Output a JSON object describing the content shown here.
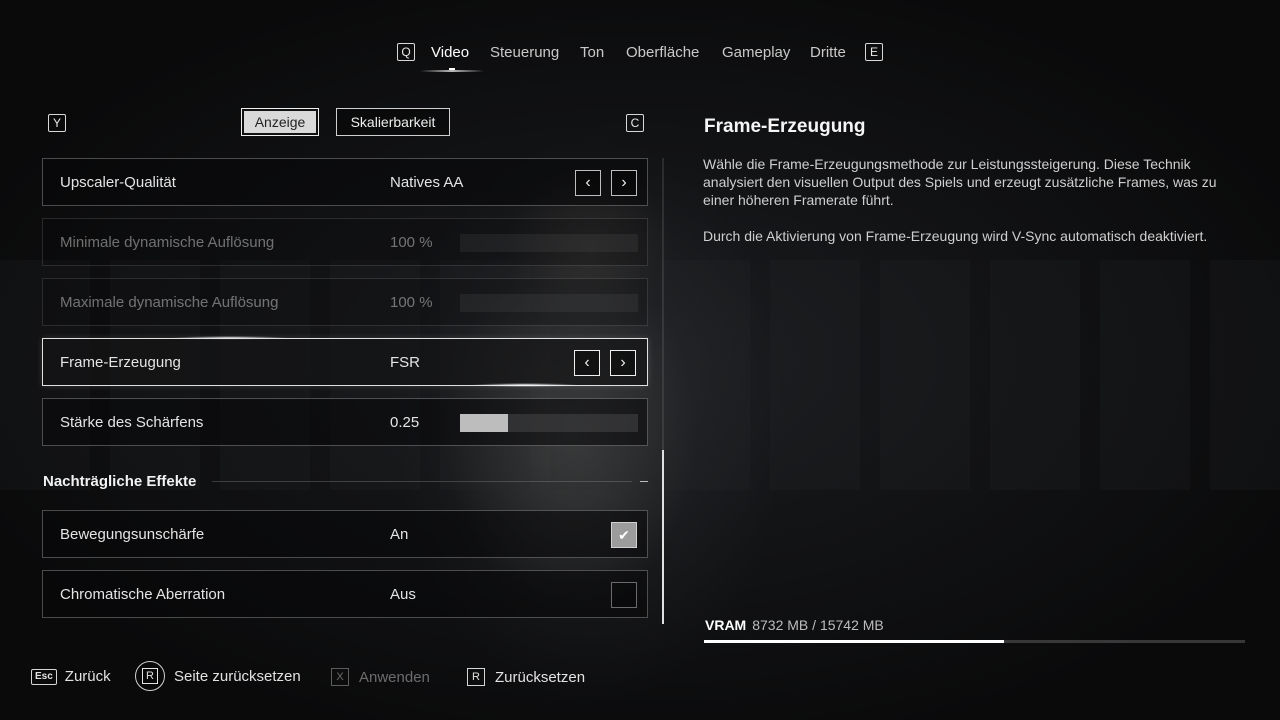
{
  "nav": {
    "left_key": "Q",
    "right_key": "E",
    "tabs": [
      {
        "label": "Video",
        "active": true
      },
      {
        "label": "Steuerung",
        "active": false
      },
      {
        "label": "Ton",
        "active": false
      },
      {
        "label": "Oberfläche",
        "active": false
      },
      {
        "label": "Gameplay",
        "active": false
      },
      {
        "label": "Dritte",
        "active": false
      }
    ]
  },
  "subnav": {
    "left_key": "Y",
    "right_key": "C",
    "tabs": [
      {
        "label": "Anzeige",
        "active": true
      },
      {
        "label": "Skalierbarkeit",
        "active": false
      }
    ]
  },
  "settings": {
    "rows": [
      {
        "label": "Upscaler-Qualität",
        "value": "Natives AA",
        "control": "selector",
        "disabled": false
      },
      {
        "label": "Minimale dynamische Auflösung",
        "value": "100 %",
        "control": "slider",
        "fill_fraction": 1.0,
        "disabled": true
      },
      {
        "label": "Maximale dynamische Auflösung",
        "value": "100 %",
        "control": "slider",
        "fill_fraction": 1.0,
        "disabled": true
      },
      {
        "label": "Frame-Erzeugung",
        "value": "FSR",
        "control": "selector",
        "disabled": false,
        "selected": true
      },
      {
        "label": "Stärke des Schärfens",
        "value": "0.25",
        "control": "slider",
        "fill_fraction": 0.27,
        "disabled": false
      }
    ],
    "section_title": "Nachträgliche Effekte",
    "section_rows": [
      {
        "label": "Bewegungsunschärfe",
        "value": "An",
        "control": "checkbox",
        "checked": true
      },
      {
        "label": "Chromatische Aberration",
        "value": "Aus",
        "control": "checkbox",
        "checked": false
      }
    ],
    "scroll_fraction": 0.63
  },
  "info": {
    "title": "Frame-Erzeugung",
    "paragraph1": "Wähle die Frame-Erzeugungsmethode zur Leistungssteigerung. Diese Technik analysiert den visuellen Output des Spiels und erzeugt zusätzliche Frames, was zu einer höheren Framerate führt.",
    "paragraph2": "Durch die Aktivierung von Frame-Erzeugung wird V-Sync automatisch deaktiviert."
  },
  "vram": {
    "label": "VRAM",
    "value": "8732 MB / 15742 MB",
    "used_fraction": 0.555
  },
  "footer": {
    "back": {
      "key": "Esc",
      "label": "Zurück"
    },
    "reset_page": {
      "key": "R",
      "label": "Seite zurücksetzen"
    },
    "apply": {
      "key": "X",
      "label": "Anwenden"
    },
    "reset": {
      "key": "R",
      "label": "Zurücksetzen"
    }
  },
  "icons": {
    "arrow_left": "‹",
    "arrow_right": "›",
    "check": "✔"
  }
}
